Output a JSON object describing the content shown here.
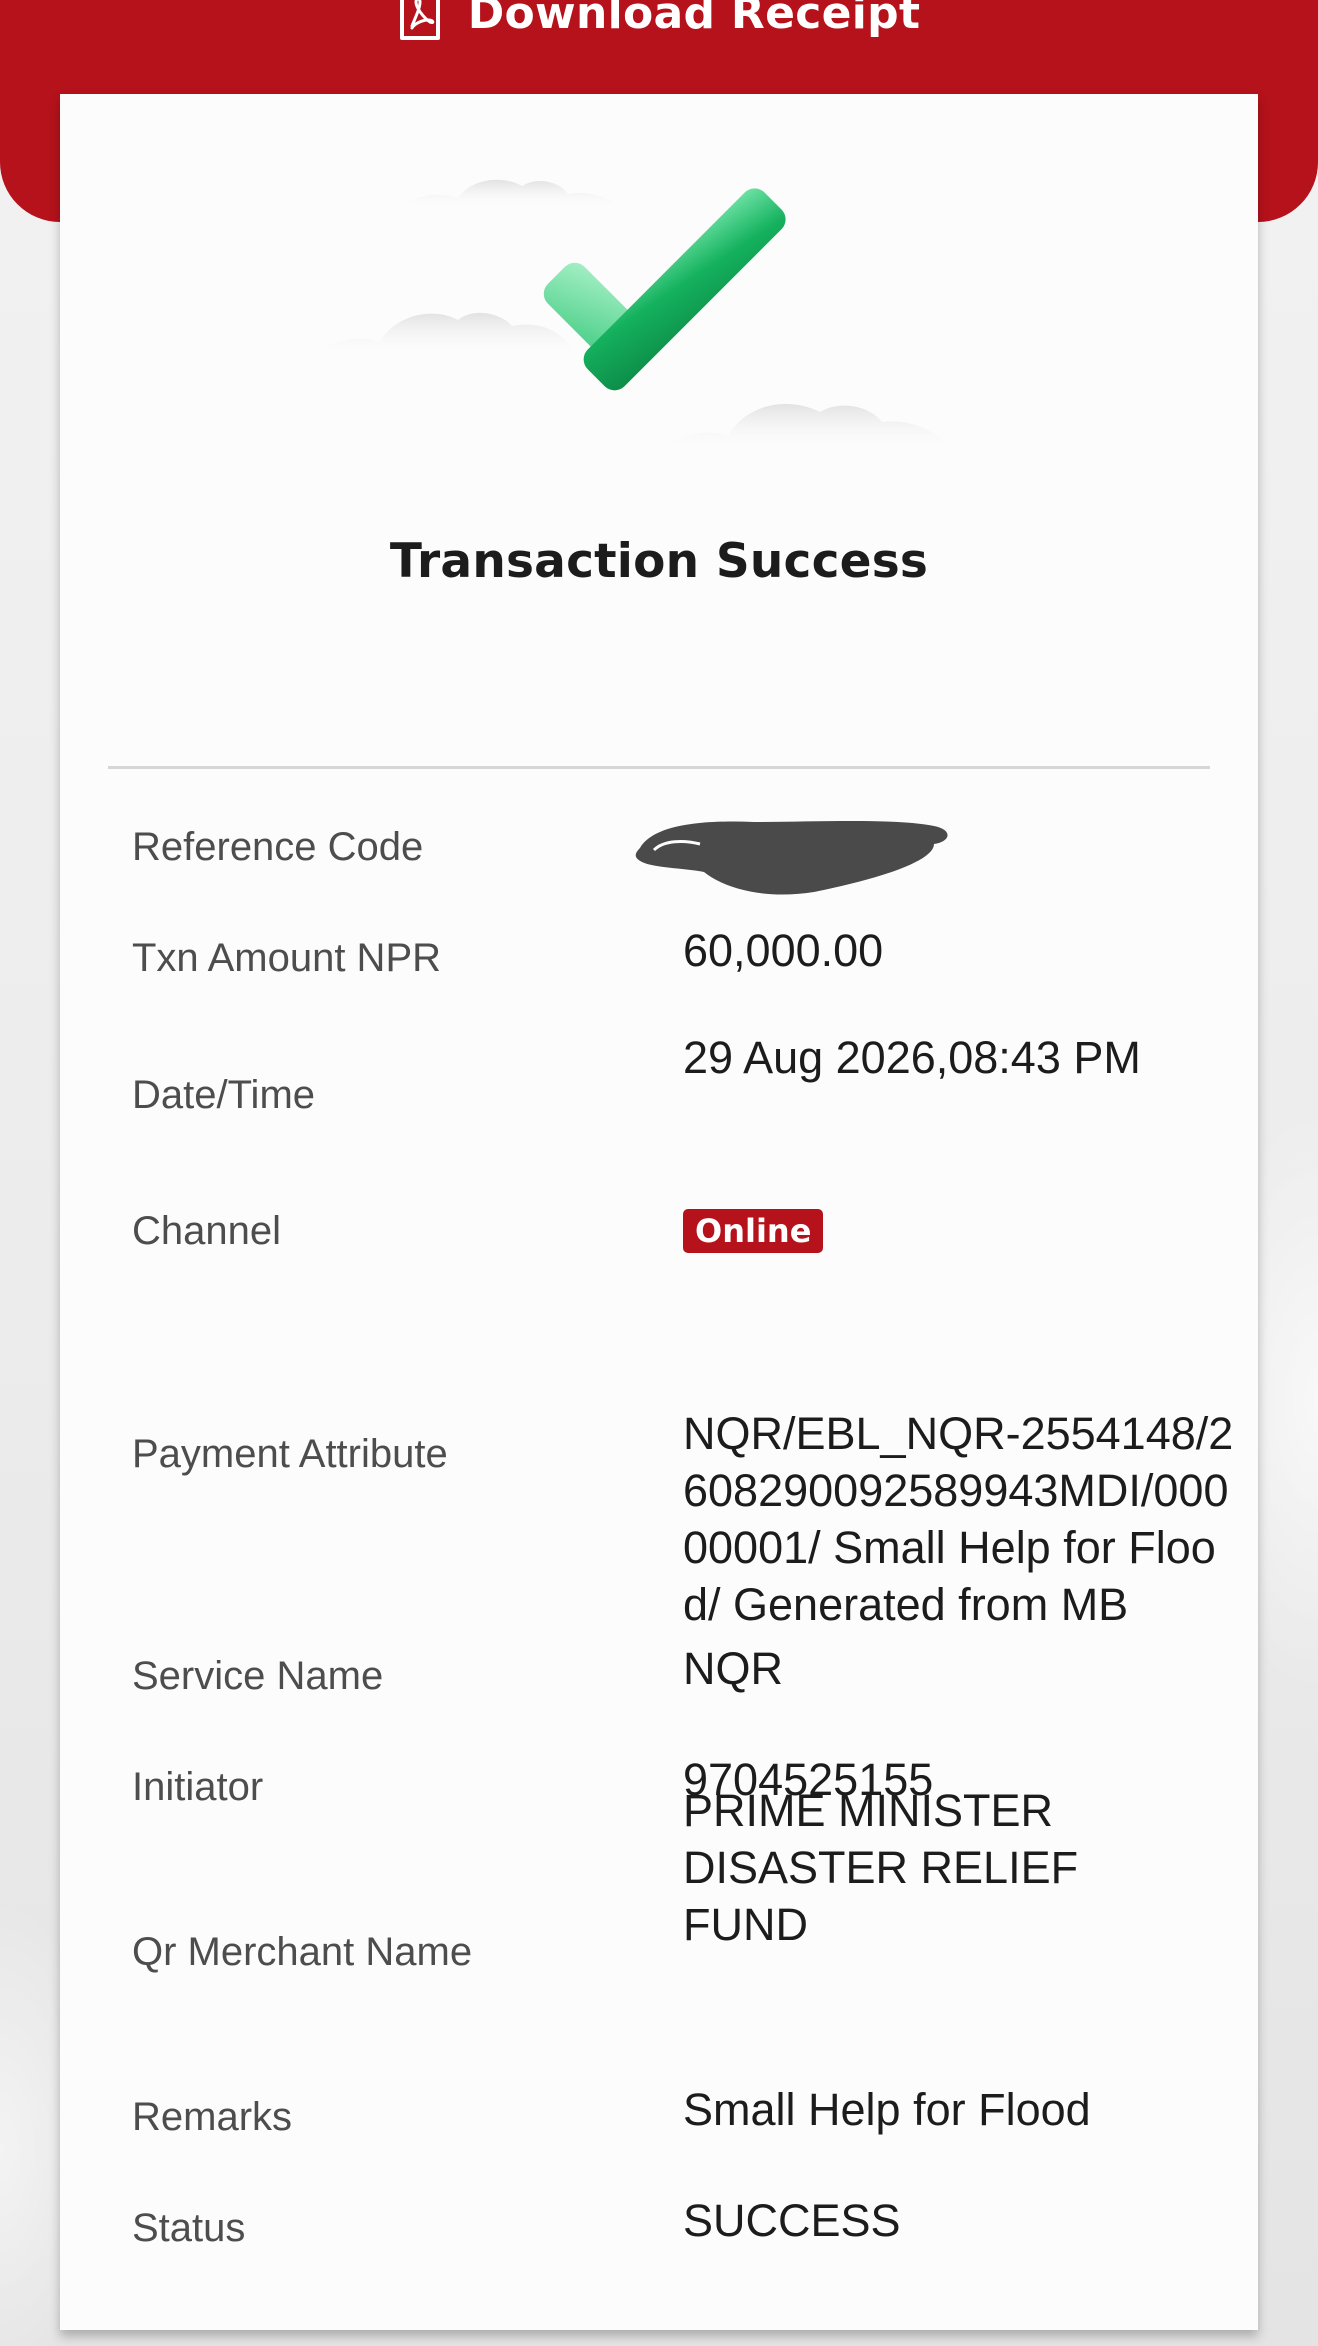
{
  "header": {
    "download_label": "Download Receipt",
    "download_icon": "pdf-file-icon",
    "brand_color": "#b5121b"
  },
  "hero": {
    "icon": "checkmark-success-icon",
    "title": "Transaction Success"
  },
  "details": {
    "reference_code": {
      "label": "Reference Code"
    },
    "txn_amount": {
      "label": "Txn Amount NPR",
      "value": "60,000.00"
    },
    "date_time": {
      "label": "Date/Time",
      "value": "29 Aug 2026,08:43 PM"
    },
    "channel": {
      "label": "Channel",
      "value": "Online"
    },
    "payment_attribute": {
      "label": "Payment Attribute",
      "value": "NQR/EBL_NQR-2554148/2608290092589943MDI/00000001/ Small Help for Flood/ Generated from MB"
    },
    "service_name": {
      "label": "Service Name",
      "value": "NQR"
    },
    "initiator": {
      "label": "Initiator",
      "value": "9704525155"
    },
    "qr_merchant_name": {
      "label": "Qr Merchant Name",
      "value": "PRIME MINISTER DISASTER RELIEF FUND"
    },
    "remarks": {
      "label": "Remarks",
      "value": "Small Help for Flood"
    },
    "status": {
      "label": "Status",
      "value": "SUCCESS"
    }
  }
}
